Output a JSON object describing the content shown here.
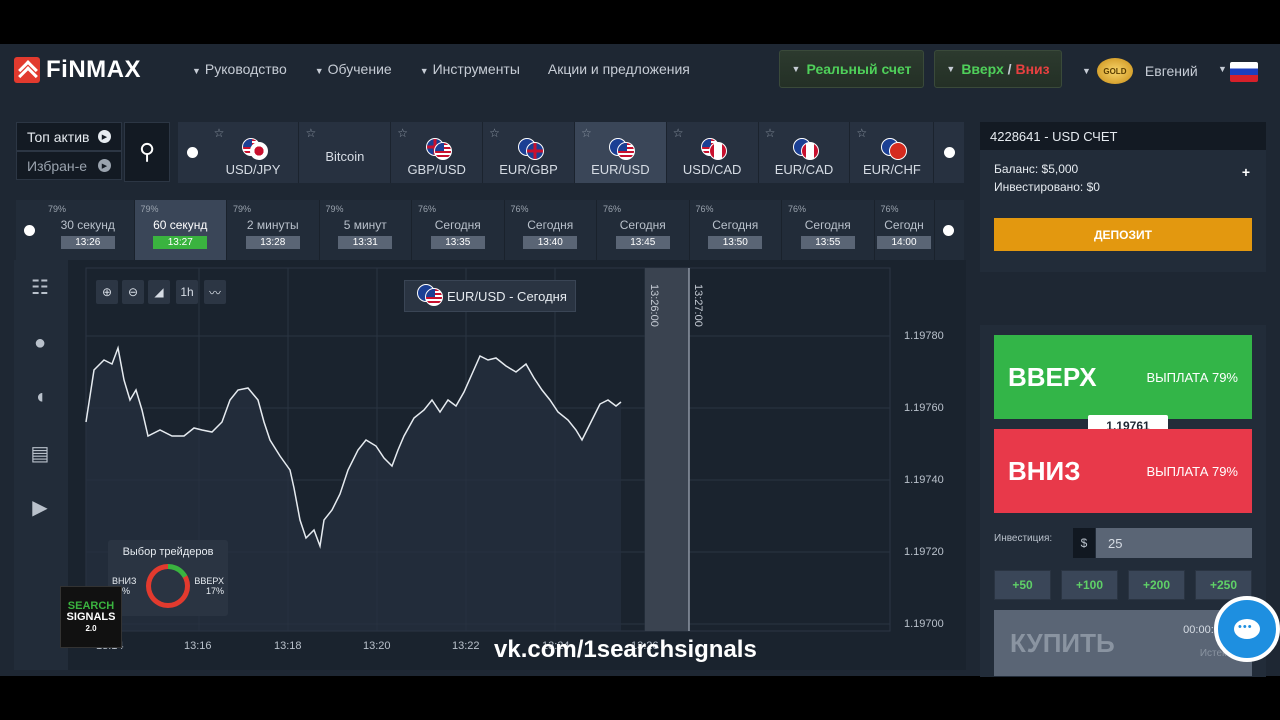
{
  "header": {
    "logo": "FiNMAX",
    "nav": [
      "Руководство",
      "Обучение",
      "Инструменты",
      "Акции и предложения"
    ],
    "real_account": "Реальный счет",
    "up_label": "Вверх",
    "slash": " / ",
    "down_label": "Вниз",
    "gold_badge": "GOLD",
    "user_name": "Евгений"
  },
  "asset_bar": {
    "top_assets": "Топ актив",
    "favorites": "Избран-е",
    "assets": [
      "USD/JPY",
      "Bitcoin",
      "GBP/USD",
      "EUR/GBP",
      "EUR/USD",
      "USD/CAD",
      "EUR/CAD",
      "EUR/CHF"
    ],
    "active_asset": "EUR/USD"
  },
  "time_bar": [
    {
      "pct": "79%",
      "label": "30 секунд",
      "time": "13:26"
    },
    {
      "pct": "79%",
      "label": "60 секунд",
      "time": "13:27"
    },
    {
      "pct": "79%",
      "label": "2 минуты",
      "time": "13:28"
    },
    {
      "pct": "79%",
      "label": "5 минут",
      "time": "13:31"
    },
    {
      "pct": "76%",
      "label": "Сегодня",
      "time": "13:35"
    },
    {
      "pct": "76%",
      "label": "Сегодня",
      "time": "13:40"
    },
    {
      "pct": "76%",
      "label": "Сегодня",
      "time": "13:45"
    },
    {
      "pct": "76%",
      "label": "Сегодня",
      "time": "13:50"
    },
    {
      "pct": "76%",
      "label": "Сегодня",
      "time": "13:55"
    },
    {
      "pct": "76%",
      "label": "Сегодн",
      "time": "14:00"
    }
  ],
  "chart": {
    "title": "EUR/USD - Сегодня",
    "zoom_1h": "1h",
    "y_ticks": [
      "1.19780",
      "1.19760",
      "1.19740",
      "1.19720",
      "1.19700"
    ],
    "x_ticks": [
      "13:14",
      "13:16",
      "13:18",
      "13:20",
      "13:22",
      "13:24",
      "13:26"
    ],
    "band_start": "13:26:00",
    "band_end": "13:27:00"
  },
  "traders": {
    "title": "Выбор трейдеров",
    "down_label": "ВНИЗ",
    "down_pct": "83%",
    "up_label": "ВВЕРХ",
    "up_pct": "17%"
  },
  "watermark": "vk.com/1searchsignals",
  "badge": {
    "line1": "SEARCH",
    "line2": "SIGNALS",
    "line3": "2.0"
  },
  "account": {
    "id_line": "4228641 - USD СЧЕТ",
    "balance": "Баланс: $5,000",
    "invested": "Инвестировано: $0",
    "deposit": "ДЕПОЗИТ"
  },
  "trade": {
    "up": "ВВЕРХ",
    "down": "ВНИЗ",
    "payout": "ВЫПЛАТА 79%",
    "price": "1.19761",
    "invest_label": "Инвестиция:",
    "currency": "$",
    "amount": "25",
    "quick": [
      "+50",
      "+100",
      "+200",
      "+250"
    ],
    "buy": "КУПИТЬ",
    "timer": "00:00:33",
    "expiry": "Истекает"
  }
}
